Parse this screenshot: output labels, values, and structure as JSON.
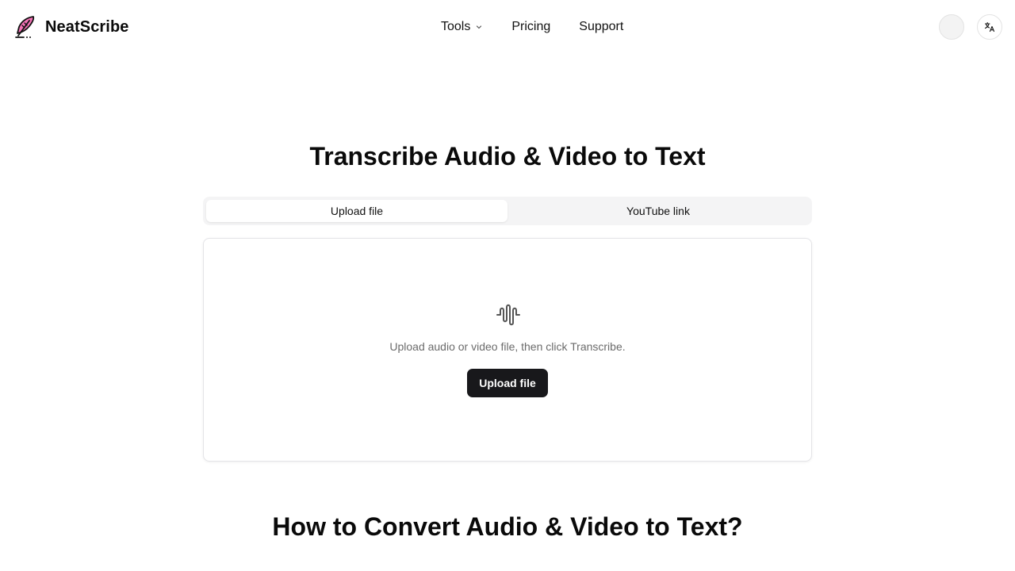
{
  "header": {
    "brand": "NeatScribe",
    "nav": {
      "tools": "Tools",
      "pricing": "Pricing",
      "support": "Support"
    }
  },
  "hero": {
    "title": "Transcribe Audio & Video to Text"
  },
  "tabs": [
    {
      "label": "Upload file",
      "active": true
    },
    {
      "label": "YouTube link",
      "active": false
    }
  ],
  "upload": {
    "hint": "Upload audio or video file, then click Transcribe.",
    "button_label": "Upload file"
  },
  "section": {
    "title": "How to Convert Audio & Video to Text?"
  },
  "colors": {
    "primary_button": "#18181b",
    "logo_accent": "#f472b6",
    "tab_bg": "#f4f4f5"
  },
  "icons": {
    "logo": "feather-pen-icon",
    "tools_dropdown": "chevron-down-icon",
    "language": "translate-icon",
    "upload_area": "audio-waveform-icon"
  }
}
